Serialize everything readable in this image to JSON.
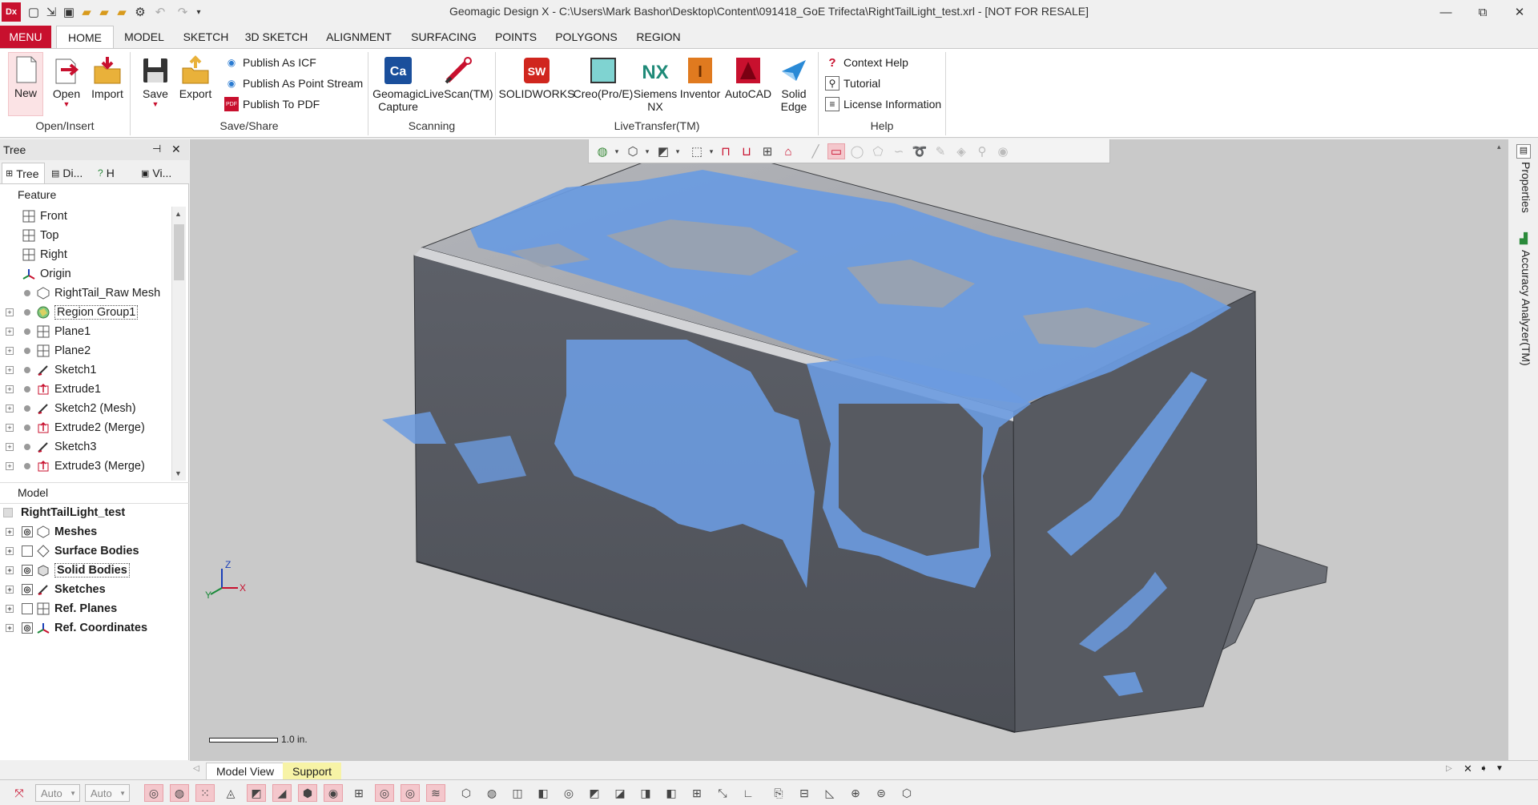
{
  "app": {
    "logo": "Dx",
    "title": "Geomagic Design X - C:\\Users\\Mark Bashor\\Desktop\\Content\\091418_GoE Trifecta\\RightTailLight_test.xrl - [NOT FOR RESALE]"
  },
  "window_controls": {
    "minimize": "—",
    "restore": "⧉",
    "close": "✕"
  },
  "ribbon": {
    "menu_label": "MENU",
    "tabs": [
      "HOME",
      "MODEL",
      "SKETCH",
      "3D SKETCH",
      "ALIGNMENT",
      "SURFACING",
      "POINTS",
      "POLYGONS",
      "REGION"
    ],
    "active_tab": "HOME",
    "groups": {
      "open_insert": {
        "label": "Open/Insert",
        "new": "New",
        "open": "Open",
        "import": "Import"
      },
      "save_share": {
        "label": "Save/Share",
        "save": "Save",
        "export": "Export",
        "publish_icf": "Publish As ICF",
        "publish_point_stream": "Publish As Point Stream",
        "publish_pdf": "Publish To PDF"
      },
      "scanning": {
        "label": "Scanning",
        "geomagic_capture": "Geomagic\nCapture",
        "livescan": "LiveScan(TM)"
      },
      "livetransfer": {
        "label": "LiveTransfer(TM)",
        "solidworks": "SOLIDWORKS",
        "creo": "Creo(Pro/E)",
        "siemens_nx": "Siemens\nNX",
        "inventor": "Inventor",
        "autocad": "AutoCAD",
        "solid_edge": "Solid\nEdge"
      },
      "help": {
        "label": "Help",
        "context_help": "Context Help",
        "tutorial": "Tutorial",
        "license": "License Information"
      }
    }
  },
  "tree_panel": {
    "title": "Tree",
    "pin": "⊣",
    "close": "✕",
    "tabs": [
      "Tree",
      "Di...",
      "H",
      "Vi..."
    ],
    "feature_label": "Feature",
    "features": [
      {
        "label": "Front",
        "icon": "plane-icon",
        "expandable": false,
        "dot": false,
        "indent": "root"
      },
      {
        "label": "Top",
        "icon": "plane-icon",
        "expandable": false,
        "dot": false,
        "indent": "root"
      },
      {
        "label": "Right",
        "icon": "plane-icon",
        "expandable": false,
        "dot": false,
        "indent": "root"
      },
      {
        "label": "Origin",
        "icon": "origin-icon",
        "expandable": false,
        "dot": false,
        "indent": "root"
      },
      {
        "label": "RightTail_Raw Mesh",
        "icon": "mesh-icon",
        "expandable": false,
        "dot": true,
        "indent": "child"
      },
      {
        "label": "Region Group1",
        "icon": "region-group-icon",
        "expandable": true,
        "dot": true,
        "indent": "child",
        "selected": true
      },
      {
        "label": "Plane1",
        "icon": "plane-icon",
        "expandable": true,
        "dot": true,
        "indent": "child"
      },
      {
        "label": "Plane2",
        "icon": "plane-icon",
        "expandable": true,
        "dot": true,
        "indent": "child"
      },
      {
        "label": "Sketch1",
        "icon": "sketch-icon",
        "expandable": true,
        "dot": true,
        "indent": "child"
      },
      {
        "label": "Extrude1",
        "icon": "extrude-icon",
        "expandable": true,
        "dot": true,
        "indent": "child"
      },
      {
        "label": "Sketch2 (Mesh)",
        "icon": "sketch-icon",
        "expandable": true,
        "dot": true,
        "indent": "child"
      },
      {
        "label": "Extrude2 (Merge)",
        "icon": "extrude-icon",
        "expandable": true,
        "dot": true,
        "indent": "child"
      },
      {
        "label": "Sketch3",
        "icon": "sketch-icon",
        "expandable": true,
        "dot": true,
        "indent": "child"
      },
      {
        "label": "Extrude3 (Merge)",
        "icon": "extrude-icon",
        "expandable": true,
        "dot": true,
        "indent": "child"
      }
    ],
    "model_label": "Model",
    "model_root": "RightTailLight_test",
    "model_items": [
      {
        "label": "Meshes",
        "icon": "mesh-icon",
        "visible": true
      },
      {
        "label": "Surface Bodies",
        "icon": "surface-icon",
        "visible": false
      },
      {
        "label": "Solid Bodies",
        "icon": "solid-icon",
        "visible": true,
        "selected": true
      },
      {
        "label": "Sketches",
        "icon": "sketch-icon",
        "visible": true
      },
      {
        "label": "Ref. Planes",
        "icon": "plane-icon",
        "visible": false
      },
      {
        "label": "Ref. Coordinates",
        "icon": "origin-icon",
        "visible": true
      }
    ]
  },
  "viewport": {
    "scale_label": "1.0 in.",
    "triad": {
      "x": "X",
      "y": "Y",
      "z": "Z"
    }
  },
  "right_rail": {
    "properties": "Properties",
    "accuracy": "Accuracy Analyzer(TM)"
  },
  "bottom_tabs": [
    "Model View",
    "Support"
  ],
  "statusbar": {
    "combo1": "Auto",
    "combo2": "Auto"
  },
  "colors": {
    "accent": "#c8102e",
    "mesh_blue": "#6b9be0",
    "solid_gray": "#5c5f66",
    "viewport_bg": "#c9c9c9"
  }
}
